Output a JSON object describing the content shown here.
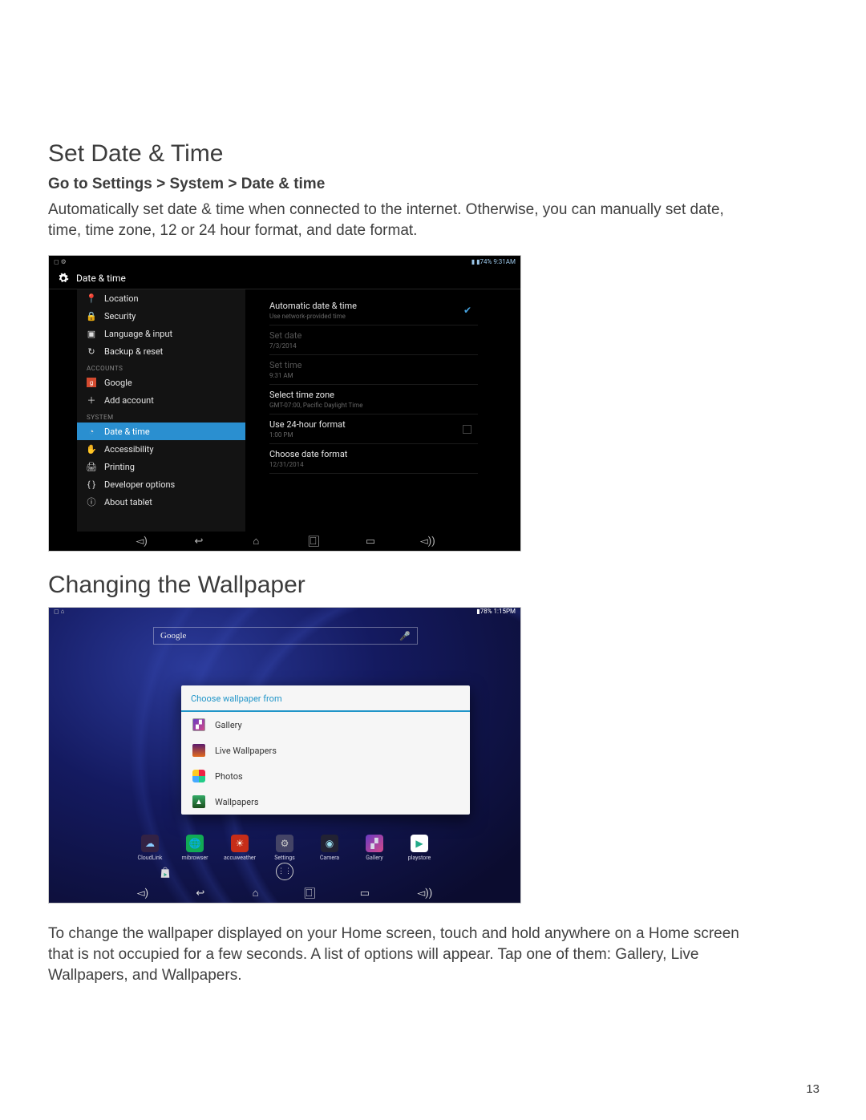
{
  "section1": {
    "heading": "Set Date & Time",
    "subheading": "Go to Settings > System > Date & time",
    "body": "Automatically set date & time when connected to the internet. Otherwise, you can manually set date, time, time zone, 12 or 24 hour format, and date format."
  },
  "section2": {
    "heading": "Changing the Wallpaper",
    "body": "To change the wallpaper displayed on your Home screen, touch and hold anywhere on a Home screen that is not occupied for a few seconds. A list of options will appear. Tap one of them: Gallery, Live Wallpapers, and Wallpapers."
  },
  "page_number": "13",
  "screenshot1": {
    "status_left": "◻ ⚙",
    "status_right": "▮ ▮74% 9:31AM",
    "title": "Date & time",
    "side_header_accounts": "ACCOUNTS",
    "side_header_system": "SYSTEM",
    "side_items": {
      "location": "Location",
      "security": "Security",
      "language": "Language & input",
      "backup": "Backup & reset",
      "google": "Google",
      "add_account": "Add account",
      "datetime": "Date & time",
      "accessibility": "Accessibility",
      "printing": "Printing",
      "developer": "Developer options",
      "about": "About tablet"
    },
    "main": {
      "auto_label": "Automatic date & time",
      "auto_sub": "Use network-provided time",
      "setdate_label": "Set date",
      "setdate_sub": "7/3/2014",
      "settime_label": "Set time",
      "settime_sub": "9:31 AM",
      "tz_label": "Select time zone",
      "tz_sub": "GMT-07:00, Pacific Daylight Time",
      "fmt24_label": "Use 24-hour format",
      "fmt24_sub": "1:00 PM",
      "datefmt_label": "Choose date format",
      "datefmt_sub": "12/31/2014"
    }
  },
  "screenshot2": {
    "status_left": "◻ ⌂",
    "status_right": "▮78% 1:15PM",
    "search_brand": "Google",
    "dialog_title": "Choose wallpaper from",
    "dialog_items": {
      "gallery": "Gallery",
      "live": "Live Wallpapers",
      "photos": "Photos",
      "wallpapers": "Wallpapers"
    },
    "dock": {
      "cloudlink": "CloudLink",
      "browser": "mibrowser",
      "accuweather": "accuweather",
      "settings": "Settings",
      "camera": "Camera",
      "gallery": "Gallery",
      "playstore": "playstore"
    }
  }
}
